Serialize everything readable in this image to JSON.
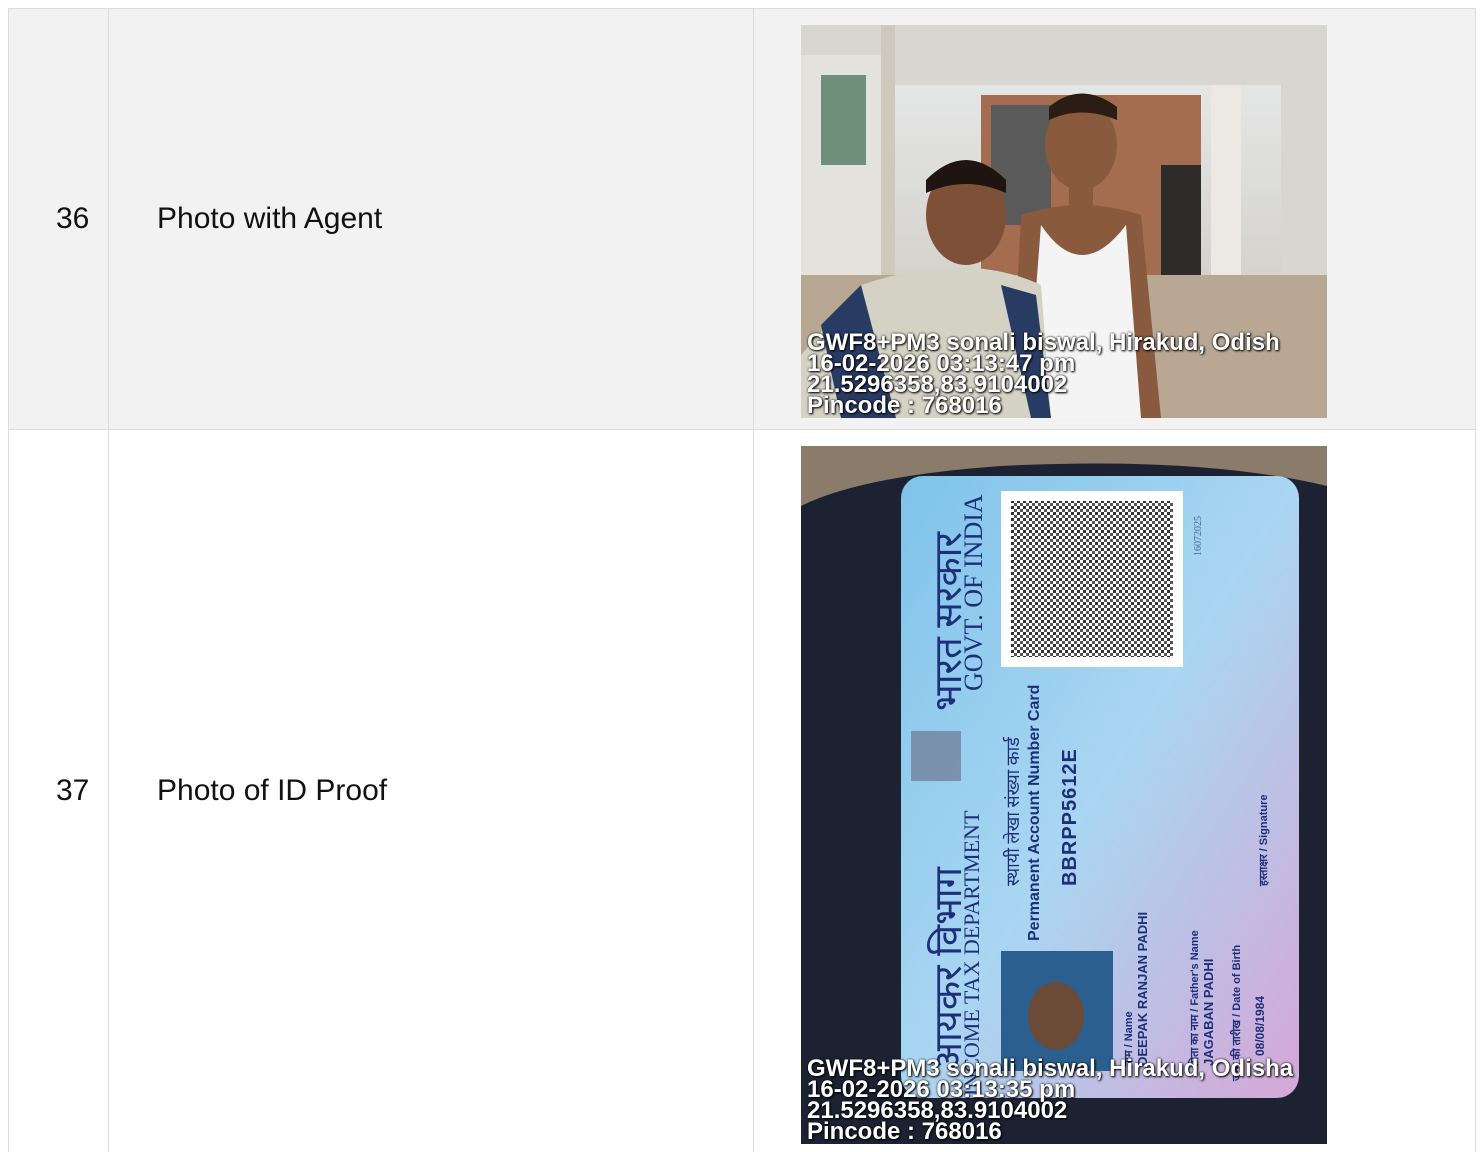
{
  "rows": [
    {
      "number": "36",
      "label": "Photo with Agent",
      "stamp": {
        "address": "GWF8+PM3 sonali biswal, Hirakud, Odish",
        "datetime": "16-02-2026 03:13:47 pm",
        "coords": "21.5296358,83.9104002",
        "pincode": "Pincode : 768016"
      }
    },
    {
      "number": "37",
      "label": "Photo of ID Proof",
      "stamp": {
        "address": "GWF8+PM3 sonali biswal, Hirakud, Odisha",
        "datetime": "16-02-2026 03:13:35 pm",
        "coords": "21.5296358,83.9104002",
        "pincode": "Pincode : 768016"
      },
      "card": {
        "hindi_govt": "भारत सरकार",
        "govt": "GOVT. OF INDIA",
        "hindi_dept": "आयकर विभाग",
        "dept": "INCOME TAX DEPARTMENT",
        "hindi_pan": "स्थायी लेखा संख्या कार्ड",
        "pan_title": "Permanent Account Number Card",
        "pan_number": "BBRPP5612E",
        "name_label": "नाम / Name",
        "name": "DEEPAK RANJAN PADHI",
        "father_label": "पिता का नाम / Father's Name",
        "father": "JAGABAN PADHI",
        "dob_label": "जन्म की तारीख / Date of Birth",
        "dob": "08/08/1984",
        "sign_label": "हस्ताक्षर / Signature",
        "serial": "16072025"
      }
    }
  ]
}
